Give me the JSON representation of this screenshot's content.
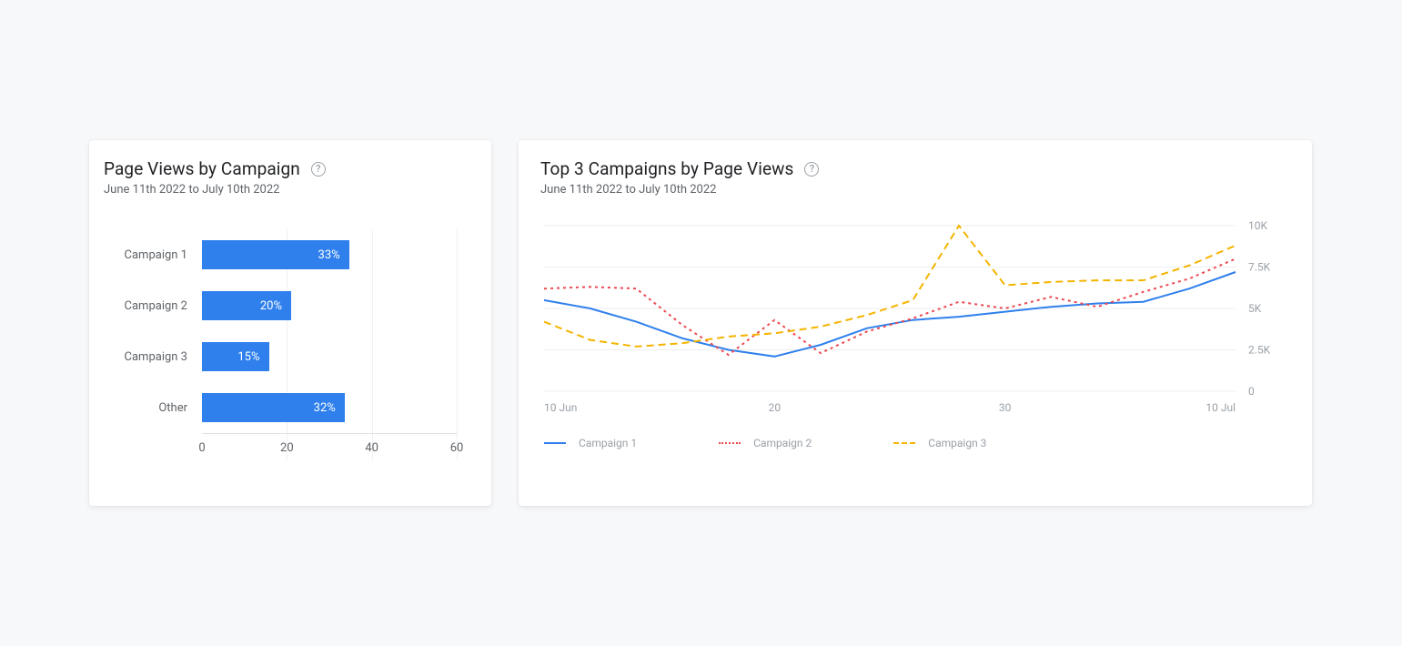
{
  "date_range": "June 11th 2022 to July 10th 2022",
  "left_card": {
    "title": "Page Views by Campaign",
    "subtitle": "June 11th 2022 to July 10th 2022"
  },
  "right_card": {
    "title": "Top 3 Campaigns by Page Views",
    "subtitle": "June 11th 2022 to July 10th 2022"
  },
  "colors": {
    "bar": "#2f80ed",
    "campaign1": "#2f80ed",
    "campaign2": "#eb4a52",
    "campaign3": "#f4b400"
  },
  "chart_data": [
    {
      "type": "bar",
      "orientation": "horizontal",
      "title": "Page Views by Campaign",
      "xlabel": "",
      "ylabel": "",
      "xlim": [
        0,
        60
      ],
      "x_ticks": [
        0,
        20,
        40,
        60
      ],
      "categories": [
        "Campaign 1",
        "Campaign 2",
        "Campaign 3",
        "Other"
      ],
      "values": [
        33,
        20,
        15,
        32
      ],
      "value_suffix": "%"
    },
    {
      "type": "line",
      "title": "Top 3 Campaigns by Page Views",
      "xlabel": "",
      "ylabel": "",
      "ylim": [
        0,
        10000
      ],
      "y_ticks": [
        0,
        2500,
        5000,
        7500,
        10000
      ],
      "y_tick_labels": [
        "0",
        "2.5K",
        "5K",
        "7.5K",
        "10K"
      ],
      "x": [
        10,
        12,
        14,
        16,
        18,
        20,
        22,
        24,
        26,
        28,
        30,
        32,
        34,
        36,
        38,
        40
      ],
      "x_tick_positions": [
        10,
        20,
        30,
        40
      ],
      "x_tick_labels": [
        "10 Jun",
        "20",
        "30",
        "10 Jul"
      ],
      "series": [
        {
          "name": "Campaign 1",
          "color": "#2f80ed",
          "style": "solid",
          "values": [
            5500,
            5000,
            4200,
            3200,
            2500,
            2100,
            2800,
            3800,
            4300,
            4500,
            4800,
            5100,
            5300,
            5400,
            6200,
            7200
          ]
        },
        {
          "name": "Campaign 2",
          "color": "#eb4a52",
          "style": "dotted",
          "values": [
            6200,
            6300,
            6200,
            4000,
            2200,
            4300,
            2300,
            3600,
            4400,
            5400,
            5000,
            5700,
            5100,
            6000,
            6800,
            8000
          ]
        },
        {
          "name": "Campaign 3",
          "color": "#f4b400",
          "style": "dashed",
          "values": [
            4200,
            3100,
            2700,
            2900,
            3300,
            3500,
            3900,
            4600,
            5500,
            10000,
            6400,
            6600,
            6700,
            6700,
            7600,
            8800
          ]
        }
      ],
      "legend": [
        "Campaign 1",
        "Campaign 2",
        "Campaign 3"
      ]
    }
  ]
}
